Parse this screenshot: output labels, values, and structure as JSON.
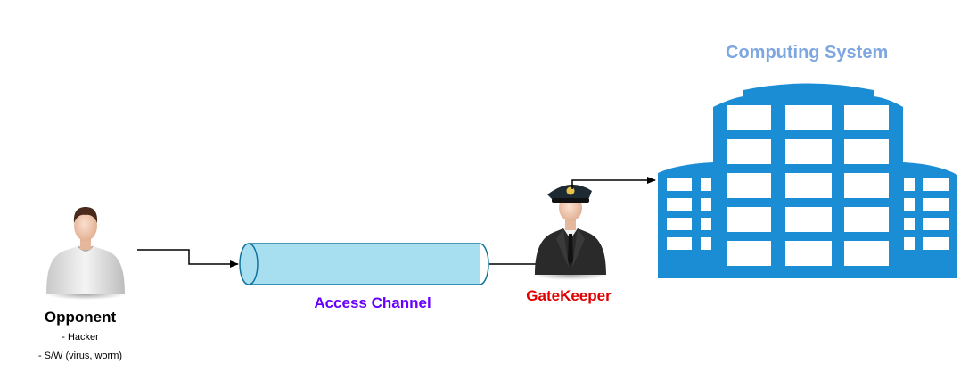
{
  "title": {
    "text": "Computing System",
    "color": "#7EA6E0"
  },
  "opponent": {
    "name": "Opponent",
    "details": [
      "- Hacker",
      "- S/W (virus, worm)"
    ],
    "icon": "person-icon"
  },
  "channel": {
    "label": "Access Channel",
    "color": "#6600FF",
    "fill": "#A8DFF0",
    "stroke": "#10739E"
  },
  "gatekeeper": {
    "label": "GateKeeper",
    "color": "#E00000",
    "icon": "pilot-icon"
  },
  "building": {
    "icon": "office-building-icon",
    "color": "#1B8DD4"
  }
}
